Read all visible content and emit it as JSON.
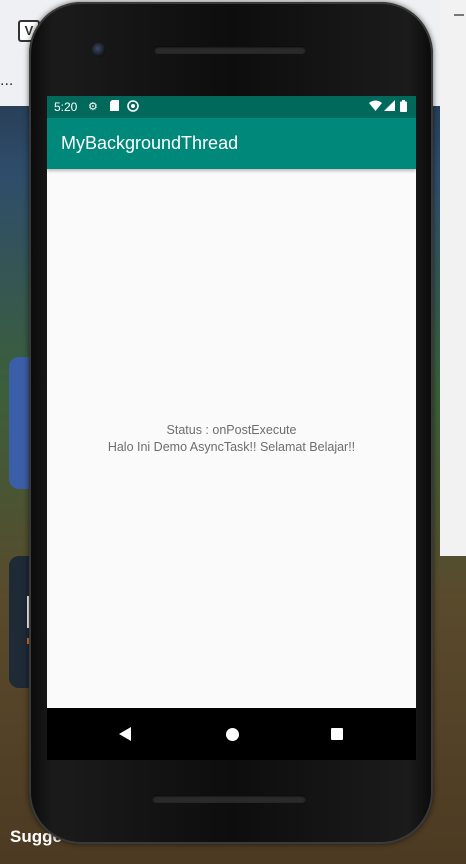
{
  "desktop": {
    "logo_text": "V",
    "topbar_ellipsis": "...",
    "suggest_text": "Sugge"
  },
  "status_bar": {
    "time": "5:20",
    "icons": [
      "settings-icon",
      "sd-card-icon",
      "sync-icon",
      "wifi-icon",
      "signal-icon",
      "battery-icon"
    ]
  },
  "app_bar": {
    "title": "MyBackgroundThread"
  },
  "content": {
    "status_line": "Status : onPostExecute",
    "message_line": "Halo Ini Demo AsyncTask!! Selamat Belajar!!"
  },
  "navigation": {
    "buttons": [
      "back",
      "home",
      "recents"
    ]
  },
  "colors": {
    "status_bar": "#00695c",
    "app_bar": "#00897b",
    "screen_background": "#fafafa",
    "text": "#6e6e6e"
  }
}
